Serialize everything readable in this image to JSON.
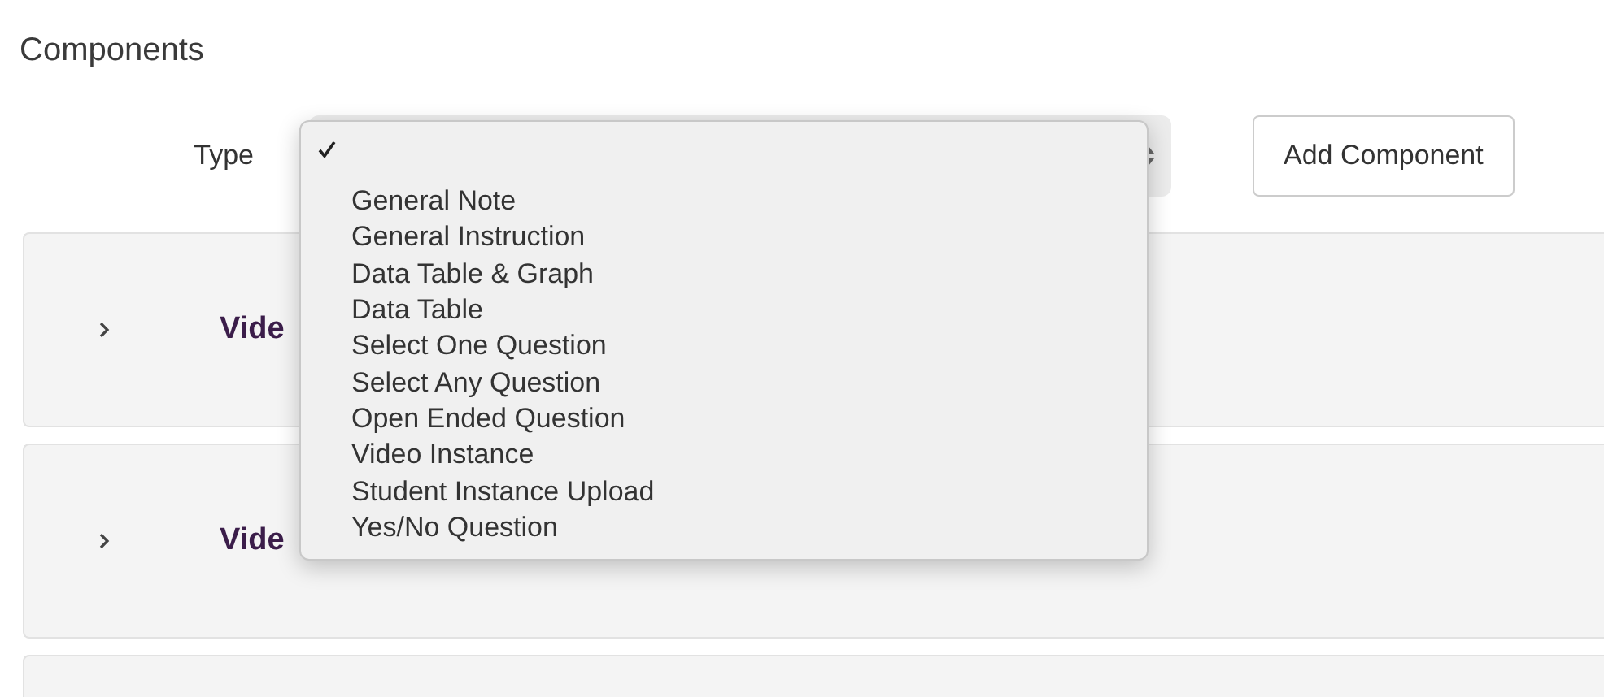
{
  "heading": "Components",
  "type_label": "Type",
  "type_select": {
    "expanded": true,
    "options": [
      {
        "selected": true
      },
      {
        "label": "General Note",
        "selected": false
      },
      {
        "label": "General Instruction",
        "selected": false
      },
      {
        "label": "Data Table & Graph",
        "selected": false
      },
      {
        "label": "Data Table",
        "selected": false
      },
      {
        "label": "Select One Question",
        "selected": false
      },
      {
        "label": "Select Any Question",
        "selected": false
      },
      {
        "label": "Open Ended Question",
        "selected": false
      },
      {
        "label": "Video Instance",
        "selected": false
      },
      {
        "label": "Student Instance Upload",
        "selected": false
      },
      {
        "label": "Yes/No Question",
        "selected": false
      }
    ]
  },
  "add_button": "Add Component",
  "components": [
    {
      "kind": "component",
      "title": "Vide",
      "expanded": false
    },
    {
      "kind": "component",
      "title": "Vide",
      "expanded": false
    },
    {
      "kind": "component"
    }
  ]
}
